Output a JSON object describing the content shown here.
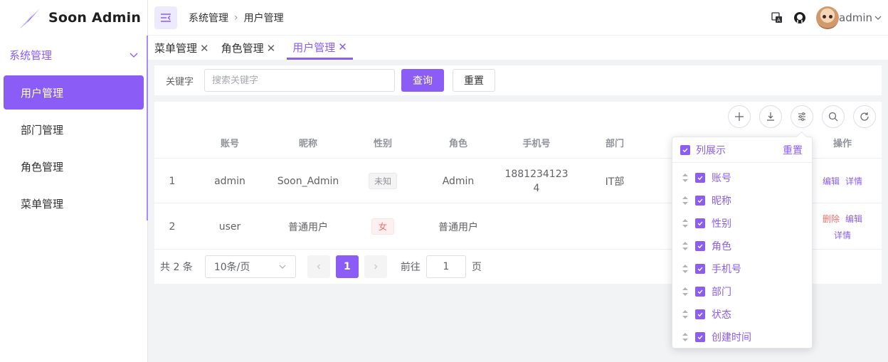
{
  "app": {
    "title": "Soon Admin"
  },
  "sidebar": {
    "group_label": "系统管理",
    "items": [
      {
        "label": "用户管理"
      },
      {
        "label": "部门管理"
      },
      {
        "label": "角色管理"
      },
      {
        "label": "菜单管理"
      }
    ]
  },
  "header": {
    "breadcrumb": [
      "系统管理",
      "用户管理"
    ],
    "user": "admin"
  },
  "tabs": [
    {
      "label": "菜单管理"
    },
    {
      "label": "角色管理"
    },
    {
      "label": "用户管理"
    }
  ],
  "search": {
    "label": "关键字",
    "placeholder": "搜索关键字",
    "query_label": "查询",
    "reset_label": "重置"
  },
  "table": {
    "columns": [
      "账号",
      "昵称",
      "性别",
      "角色",
      "手机号",
      "部门",
      "操作"
    ],
    "rows": [
      {
        "index": "1",
        "account": "admin",
        "nickname": "Soon_Admin",
        "gender": "未知",
        "role": "Admin",
        "phone_line1": "1881234123",
        "phone_line2": "4",
        "dept": "IT部",
        "actions": [
          "编辑",
          "详情"
        ]
      },
      {
        "index": "2",
        "account": "user",
        "nickname": "普通用户",
        "gender": "女",
        "role": "普通用户",
        "phone_line1": "",
        "phone_line2": "",
        "dept": "",
        "actions": [
          "删除",
          "编辑",
          "详情"
        ]
      }
    ]
  },
  "pagination": {
    "total": "共 2 条",
    "page_size": "10条/页",
    "current": "1",
    "goto_prefix": "前往",
    "goto_value": "1",
    "goto_suffix": "页"
  },
  "column_popover": {
    "title": "列展示",
    "reset": "重置",
    "columns": [
      "账号",
      "昵称",
      "性别",
      "角色",
      "手机号",
      "部门",
      "状态",
      "创建时间"
    ]
  },
  "colors": {
    "accent": "#8b5cf6",
    "danger": "#f56c6c"
  }
}
